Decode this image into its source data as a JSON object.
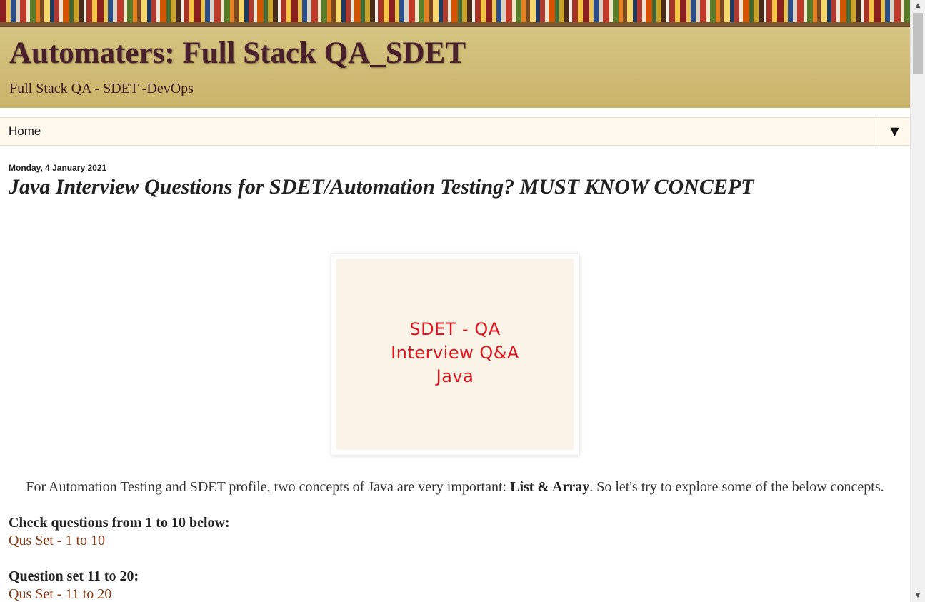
{
  "blog": {
    "title": "Automaters: Full Stack QA_SDET",
    "description": "Full Stack QA - SDET -DevOps"
  },
  "nav": {
    "home_label": "Home",
    "toggle_glyph": "▼"
  },
  "post": {
    "date": "Monday, 4 January 2021",
    "title": "Java Interview Questions for SDET/Automation Testing? MUST KNOW CONCEPT",
    "image": {
      "line1": "SDET - QA",
      "line2": "Interview Q&A",
      "line3": "Java",
      "text_color": "#e0141e",
      "background": "#faf3e8"
    },
    "intro_before": "For Automation Testing and SDET profile, two concepts of Java are very important: ",
    "intro_bold": "List & Array",
    "intro_after": ". So let's try to explore some of the below concepts.",
    "sections": [
      {
        "heading": "Check questions from 1 to 10 below:",
        "link": "Qus Set - 1 to 10"
      },
      {
        "heading": "Question set 11 to 20:",
        "link": "Qus Set - 11 to 20"
      }
    ]
  },
  "scrollbar": {
    "up_glyph": "▲",
    "down_glyph": "▼"
  },
  "colors": {
    "header_bg": "#d0bd74",
    "title_color": "#4a1f2c",
    "nav_bg": "#fff8ec",
    "link_color": "#8a3a14"
  }
}
